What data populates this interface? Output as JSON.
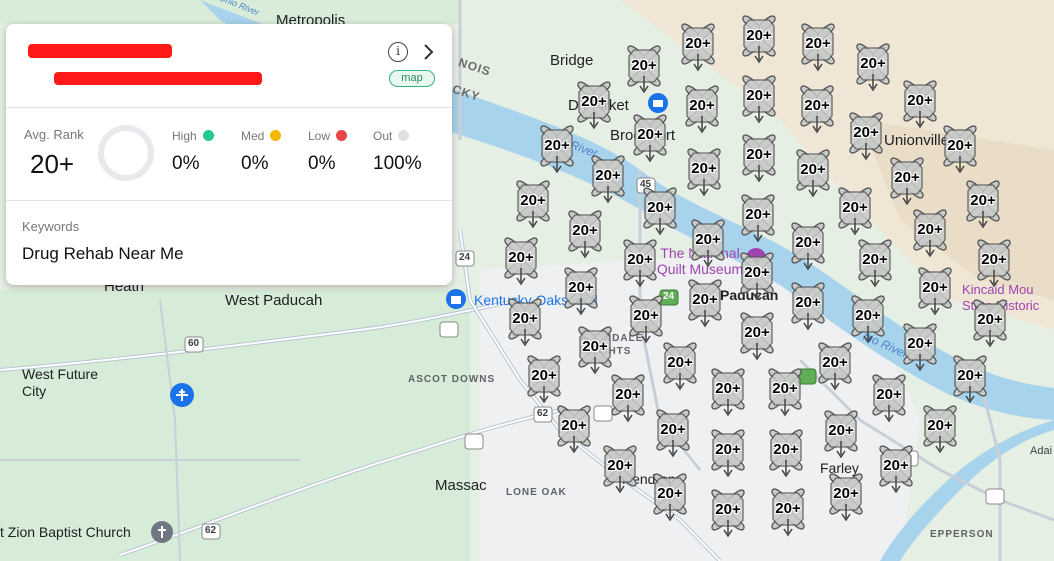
{
  "card": {
    "map_badge": "map",
    "avg_rank_label": "Avg. Rank",
    "avg_rank_value": "20+",
    "stats": [
      {
        "label": "High",
        "value": "0%",
        "color": "#22c98a"
      },
      {
        "label": "Med",
        "value": "0%",
        "color": "#f5b800"
      },
      {
        "label": "Low",
        "value": "0%",
        "color": "#e84545"
      },
      {
        "label": "Out",
        "value": "100%",
        "color": "#dde0e4"
      }
    ],
    "keywords_label": "Keywords",
    "keyword": "Drug Rehab Near Me"
  },
  "icons": {
    "info": "info-icon",
    "next": "chevron-right-icon"
  },
  "pin_label": "20+",
  "map_labels": {
    "metropolis": "Metropolis",
    "bridge": "Bridge",
    "illinois": "NOIS",
    "kentucky": "CKY",
    "market": "D Market",
    "brookport": "Brookport",
    "unionville": "Unionville",
    "river": "River",
    "quilt_museum": "The National Quilt Museum",
    "paducah": "Paducah",
    "heath": "Heath",
    "west_paducah": "West Paducah",
    "mall": "Kentucky Oaks Mall",
    "avondale": "AVONDALE HEIGHTS",
    "west_future_city": "West Future City",
    "ascot_downs": "ASCOT DOWNS",
    "massac": "Massac",
    "lone_oak": "LONE OAK",
    "hendron": "Hendron",
    "farley": "Farley",
    "zion": "t Zion Baptist Church",
    "kincaid": "Kincaid Mou State Historic",
    "ohio_river": "hio River",
    "epperson": "EPPERSON",
    "adair": "Adai",
    "ohio_river_top": "Ohio River"
  },
  "highway_shields": [
    "60",
    "24",
    "45",
    "62",
    "24",
    "62"
  ],
  "colors": {
    "water": "#a8d3ec",
    "land": "#e8f0e6",
    "park": "#c6e8cf",
    "urban": "#eceef1",
    "pin_fill": "#c9cbc9",
    "pin_stroke": "#555555"
  }
}
